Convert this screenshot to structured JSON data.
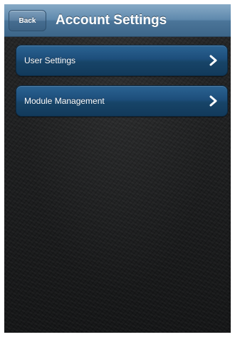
{
  "navbar": {
    "back_label": "Back",
    "title": "Account Settings"
  },
  "menu": {
    "items": [
      {
        "label": "User Settings",
        "icon": "chevron-right-icon"
      },
      {
        "label": "Module Management",
        "icon": "chevron-right-icon"
      }
    ]
  },
  "colors": {
    "navbar": "#5f89ad",
    "row": "#1d4e7b",
    "background": "#1d1e1f",
    "text": "#ffffff"
  }
}
